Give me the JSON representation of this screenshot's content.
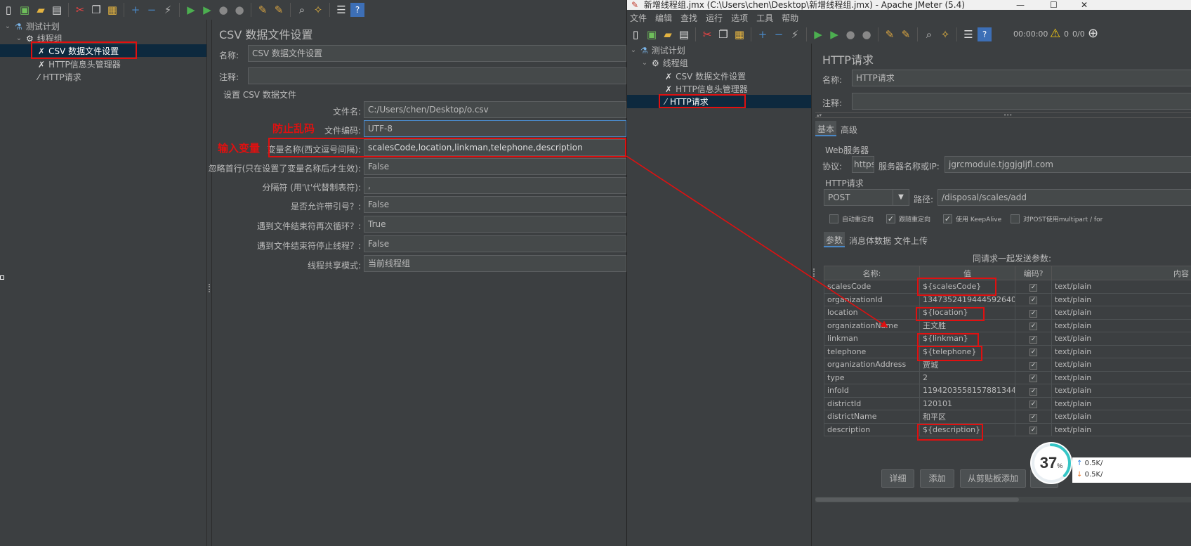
{
  "left": {
    "tree": {
      "root": "测试计划",
      "thread_group": "线程组",
      "csv": "CSV 数据文件设置",
      "header_mgr": "HTTP信息头管理器",
      "http": "HTTP请求"
    },
    "panel": {
      "title": "CSV 数据文件设置",
      "name_label": "名称:",
      "name_value": "CSV 数据文件设置",
      "comment_label": "注释:",
      "comment_value": "",
      "section": "设置 CSV 数据文件",
      "rows": [
        {
          "label": "文件名:",
          "value": "C:/Users/chen/Desktop/o.csv"
        },
        {
          "label": "文件编码:",
          "value": "UTF-8"
        },
        {
          "label": "变量名称(西文逗号间隔):",
          "value": "scalesCode,location,linkman,telephone,description"
        },
        {
          "label": "忽略首行(只在设置了变量名称后才生效):",
          "value": "False"
        },
        {
          "label": "分隔符 (用'\\t'代替制表符):",
          "value": ","
        },
        {
          "label": "是否允许带引号？:",
          "value": "False"
        },
        {
          "label": "遇到文件结束符再次循环？:",
          "value": "True"
        },
        {
          "label": "遇到文件结束符停止线程？:",
          "value": "False"
        },
        {
          "label": "线程共享模式:",
          "value": "当前线程组"
        }
      ],
      "annot_encoding": "防止乱码",
      "annot_vars": "输入变量"
    }
  },
  "right": {
    "title": "新增线程组.jmx (C:\\Users\\chen\\Desktop\\新增线程组.jmx) - Apache JMeter (5.4)",
    "menu": [
      "文件",
      "编辑",
      "查找",
      "运行",
      "选项",
      "工具",
      "帮助"
    ],
    "status": {
      "time": "00:00:00",
      "warn": "0",
      "threads": "0/0"
    },
    "tree": {
      "root": "测试计划",
      "thread_group": "线程组",
      "csv": "CSV 数据文件设置",
      "header_mgr": "HTTP信息头管理器",
      "http": "HTTP请求"
    },
    "panel": {
      "title": "HTTP请求",
      "name_label": "名称:",
      "name_value": "HTTP请求",
      "comment_label": "注释:",
      "comment_value": "",
      "tab_basic": "基本",
      "tab_advanced": "高级",
      "web_server": "Web服务器",
      "protocol_label": "协议:",
      "protocol_value": "https",
      "server_label": "服务器名称或IP:",
      "server_value": "jgrcmodule.tjggjgljfl.com",
      "http_request": "HTTP请求",
      "method": "POST",
      "path_label": "路径:",
      "path_value": "/disposal/scales/add",
      "cb_redirect": "自动重定向",
      "cb_follow": "跟随重定向",
      "cb_keepalive": "使用 KeepAlive",
      "cb_multipart": "对POST使用multipart / for",
      "tab_params": "参数",
      "tab_body": "消息体数据",
      "tab_files": "文件上传",
      "send_with": "同请求一起发送参数:",
      "col_name": "名称:",
      "col_value": "值",
      "col_encode": "编码?",
      "col_content": "内容",
      "params": [
        {
          "name": "scalesCode",
          "value": "${scalesCode}",
          "type": "text/plain"
        },
        {
          "name": "organizationId",
          "value": "1347352419444592640",
          "type": "text/plain"
        },
        {
          "name": "location",
          "value": "${location}",
          "type": "text/plain"
        },
        {
          "name": "organizationName",
          "value": "王文胜",
          "type": "text/plain"
        },
        {
          "name": "linkman",
          "value": "${linkman}",
          "type": "text/plain"
        },
        {
          "name": "telephone",
          "value": "${telephone}",
          "type": "text/plain"
        },
        {
          "name": "organizationAddress",
          "value": "贾城",
          "type": "text/plain"
        },
        {
          "name": "type",
          "value": "2",
          "type": "text/plain"
        },
        {
          "name": "infoId",
          "value": "1194203558157881344",
          "type": "text/plain"
        },
        {
          "name": "districtId",
          "value": "120101",
          "type": "text/plain"
        },
        {
          "name": "districtName",
          "value": "和平区",
          "type": "text/plain"
        },
        {
          "name": "description",
          "value": "${description}",
          "type": "text/plain"
        }
      ],
      "btn_detail": "详细",
      "btn_add": "添加",
      "btn_clipboard": "从剪贴板添加"
    }
  },
  "gauge": {
    "value": "37",
    "unit": "%",
    "up": "0.5K/",
    "down": "0.5K/"
  },
  "colors": {
    "annotation": "#e01010",
    "selection": "#0d293e",
    "accent": "#4a88c7"
  }
}
